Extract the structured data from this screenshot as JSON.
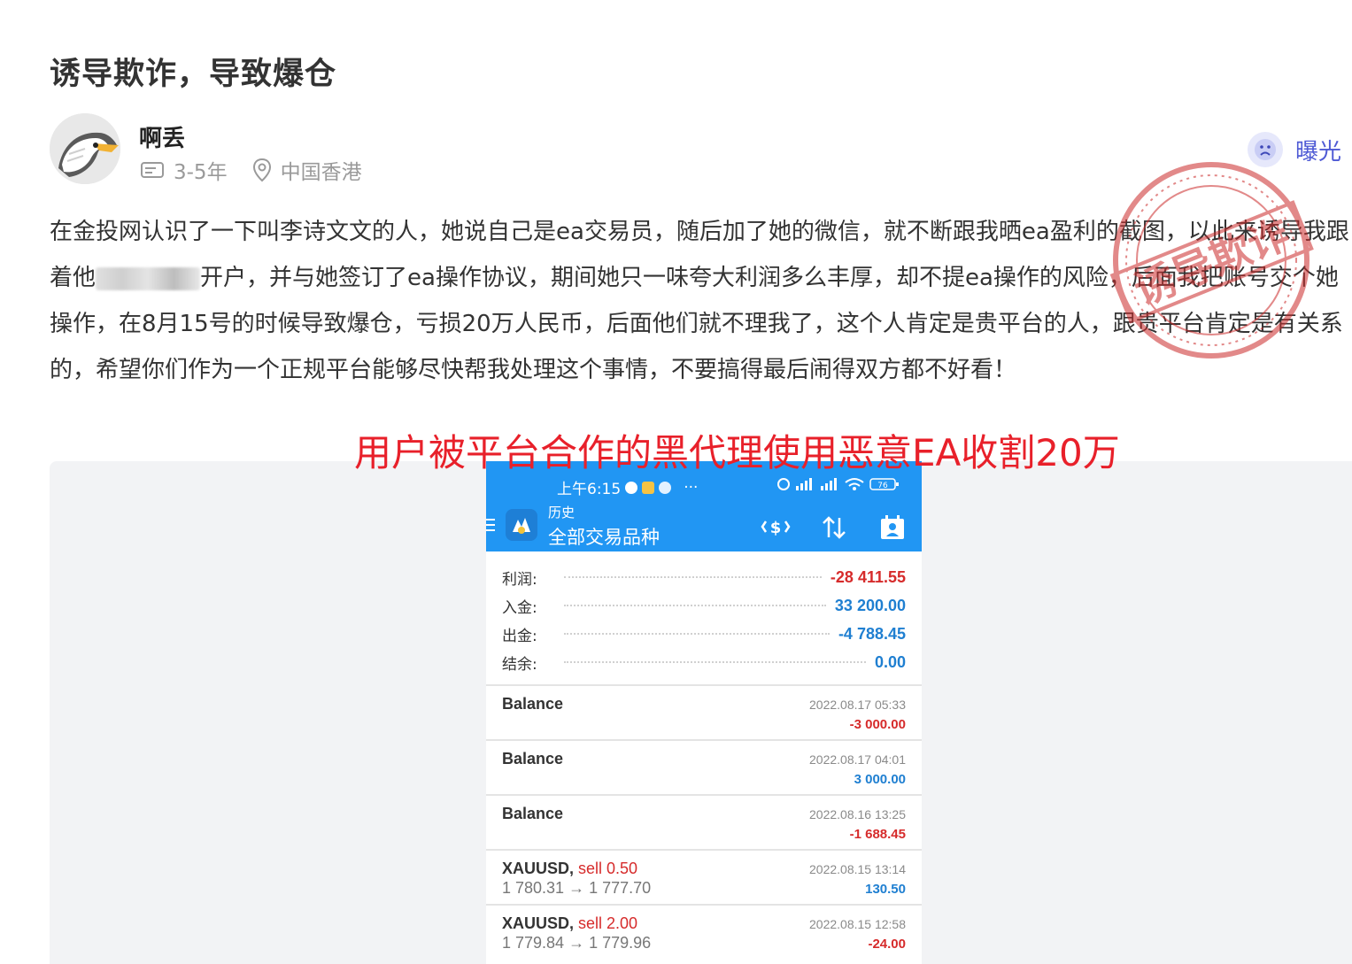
{
  "post": {
    "title": "诱导欺诈，导致爆仓",
    "author": "啊丢",
    "experience": "3-5年",
    "location": "中国香港",
    "expose_label": "曝光",
    "body_before_blur": "在金投网认识了一下叫李诗文文的人，她说自己是ea交易员，随后加了她的微信，就不断跟我晒ea盈利的截图，以此来诱导我跟着他",
    "body_after_blur": "开户，并与她签订了ea操作协议，期间她只一味夸大利润多么丰厚，却不提ea操作的风险，后面我把账号交个她操作，在8月15号的时候导致爆仓，亏损20万人民币，后面他们就不理我了，这个人肯定是贵平台的人，跟贵平台肯定是有关系的，希望你们作为一个正规平台能够尽快帮我处理这个事情，不要搞得最后闹得双方都不好看！",
    "stamp_text": "诱导欺诈",
    "caption": "用户被平台合作的黑代理使用恶意EA收割20万"
  },
  "phone": {
    "status_time": "上午6:15",
    "status_dots": "···",
    "battery": "76",
    "subtitle": "历史",
    "title": "全部交易品种",
    "summary": [
      {
        "label": "利润:",
        "value": "-28 411.55",
        "tone": "neg"
      },
      {
        "label": "入金:",
        "value": "33 200.00",
        "tone": "pos"
      },
      {
        "label": "出金:",
        "value": "-4 788.45",
        "tone": "pos"
      },
      {
        "label": "结余:",
        "value": "0.00",
        "tone": "pos"
      }
    ],
    "transactions": [
      {
        "name": "Balance",
        "type": "",
        "price": "",
        "date": "2022.08.17 05:33",
        "amount": "-3 000.00",
        "tone": "neg"
      },
      {
        "name": "Balance",
        "type": "",
        "price": "",
        "date": "2022.08.17 04:01",
        "amount": "3 000.00",
        "tone": "pos"
      },
      {
        "name": "Balance",
        "type": "",
        "price": "",
        "date": "2022.08.16 13:25",
        "amount": "-1 688.45",
        "tone": "neg"
      },
      {
        "name": "XAUUSD,",
        "type": " sell 0.50",
        "price": "1 780.31 → 1 777.70",
        "date": "2022.08.15 13:14",
        "amount": "130.50",
        "tone": "pos"
      },
      {
        "name": "XAUUSD,",
        "type": " sell 2.00",
        "price": "1 779.84 → 1 779.96",
        "date": "2022.08.15 12:58",
        "amount": "-24.00",
        "tone": "neg"
      }
    ]
  },
  "colors": {
    "accent": "#4f5bd5",
    "phone_bar": "#2196f3",
    "negative": "#d62b2b",
    "positive": "#1f7fd1",
    "caption": "#e8202a",
    "stamp": "#cc2a2a"
  }
}
